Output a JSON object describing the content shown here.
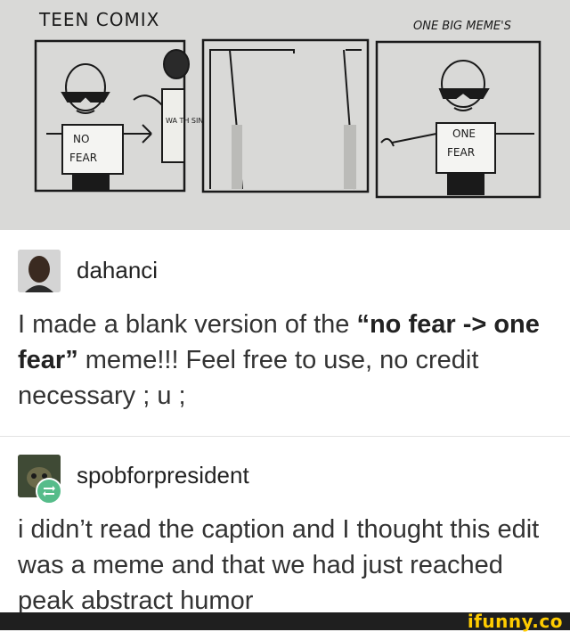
{
  "comic": {
    "title_left": "TEEN COMIX",
    "title_right": "ONE BIG MEME'S",
    "panel1_shirt_line1": "NO",
    "panel1_shirt_line2": "FEAR",
    "panel2_sign": "WA TH SIN",
    "panel4_shirt_line1": "ONE",
    "panel4_shirt_line2": "FEAR"
  },
  "posts": [
    {
      "username": "dahanci",
      "text_segments": [
        {
          "text": "I made a blank version of the ",
          "bold": false
        },
        {
          "text": "“no fear -> one fear”",
          "bold": true
        },
        {
          "text": " meme!!! Feel free to use, no credit necessary ; u ;",
          "bold": false
        }
      ]
    },
    {
      "username": "spobforpresident",
      "text": "i didn’t read the caption and I thought this edit was a meme and that we had just reached peak abstract humor"
    }
  ],
  "footer": {
    "watermark": "ifunny.co"
  },
  "colors": {
    "reblog": "#56bc8a",
    "watermark": "#ffcc00",
    "bar": "#1f1f1f"
  },
  "icons": [
    "avatar-dahanci",
    "avatar-spobforpresident",
    "reblog-icon"
  ]
}
